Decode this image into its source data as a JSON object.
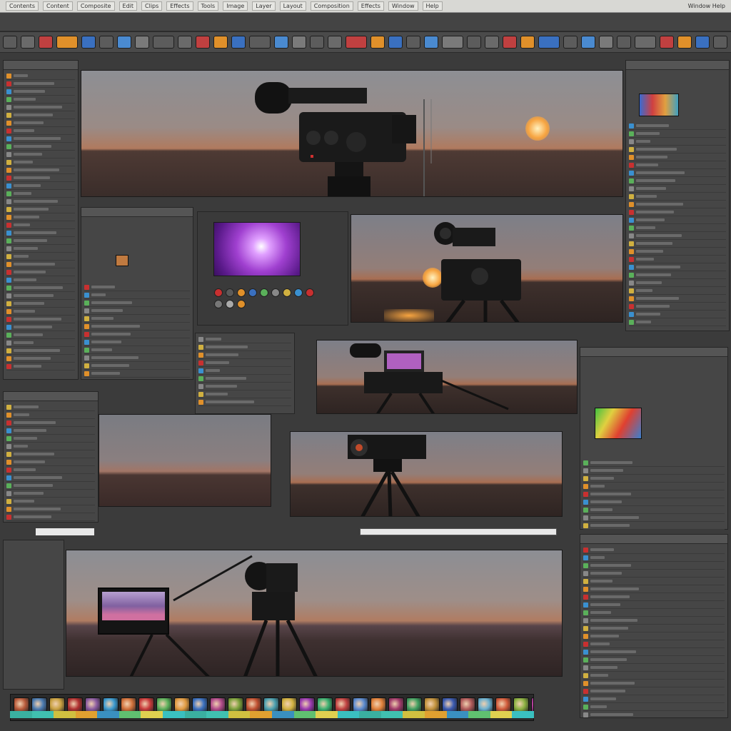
{
  "menubar": {
    "items": [
      "Contents",
      "Content",
      "Composite",
      "Edit",
      "Clips",
      "Effects",
      "Tools",
      "Image",
      "Layer",
      "Layout",
      "Composition",
      "Effects",
      "Window",
      "Help"
    ],
    "right_label": "Window Help"
  },
  "toolbar": {
    "button_count": 40
  },
  "filmstrip": {
    "thumbnail_colors": [
      "#b85a3a",
      "#4a7ab0",
      "#c8a040",
      "#b03030",
      "#8a5aa0",
      "#3a9ad0",
      "#d0703a",
      "#c83a3a",
      "#5ab05a",
      "#e09a40",
      "#3a70c0",
      "#b04a8a",
      "#7aa03a",
      "#c05030",
      "#4aa0b0",
      "#d0b040",
      "#9a3ab0",
      "#3ab070",
      "#c04040",
      "#5a8ad0",
      "#e0803a",
      "#a03a6a",
      "#40a060",
      "#c0903a",
      "#3a5ab0",
      "#b05a5a",
      "#6ab0d0",
      "#d05a3a",
      "#8ab040",
      "#b03a9a"
    ],
    "bar_colors": [
      "#3ab0a0",
      "#40c0b0",
      "#d0c040",
      "#e0a030",
      "#3a90c0",
      "#60c070",
      "#e0d050",
      "#3ac0c0"
    ]
  },
  "colors": {
    "accent_orange": "#e0902a",
    "accent_red": "#c83030",
    "panel_bg": "#464646"
  }
}
